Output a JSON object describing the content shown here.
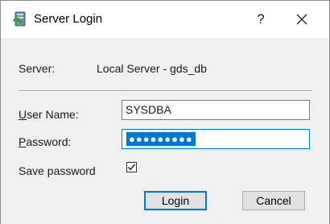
{
  "window": {
    "title": "Server Login",
    "help_glyph": "?",
    "icon": "server-app-icon",
    "close_icon": "close-icon"
  },
  "server": {
    "label": "Server:",
    "value": "Local Server - gds_db"
  },
  "username": {
    "label_mnemonic": "U",
    "label_rest": "ser Name:",
    "value": "SYSDBA"
  },
  "password": {
    "label_mnemonic": "P",
    "label_rest": "assword:",
    "masked_value": "●●●●●●●●●"
  },
  "save_password": {
    "label": "Save password",
    "checked": true
  },
  "buttons": {
    "login": "Login",
    "cancel": "Cancel"
  },
  "colors": {
    "accent": "#0078d7",
    "panel": "#f0f0f0",
    "button": "#e1e1e1"
  }
}
